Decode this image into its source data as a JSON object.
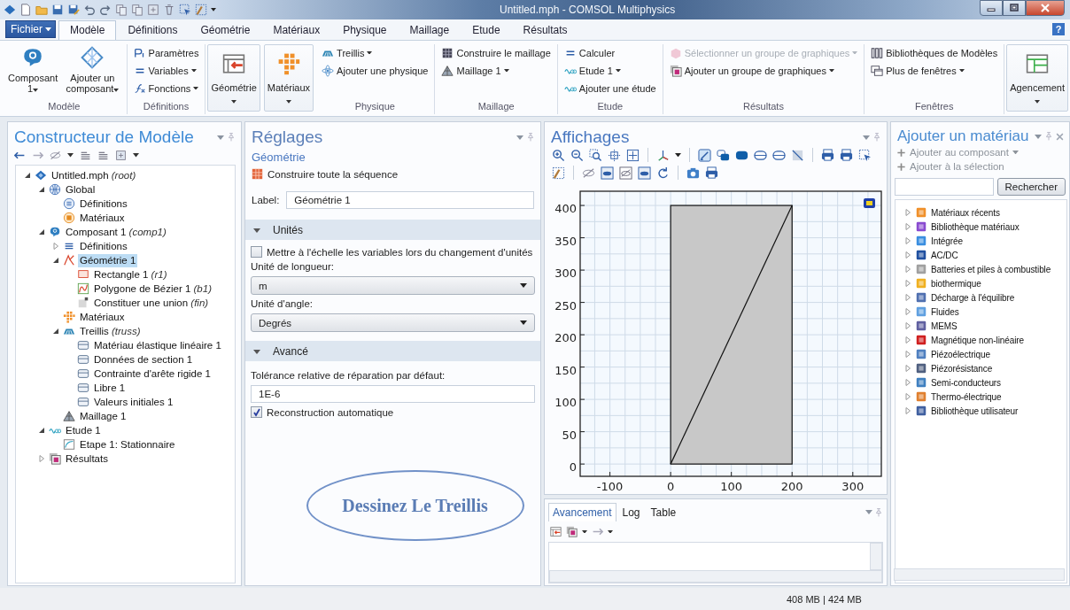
{
  "window": {
    "title": "Untitled.mph - COMSOL Multiphysics"
  },
  "menu_tabs": [
    {
      "label": "Fichier",
      "kind": "file",
      "selected": false
    },
    {
      "label": "Modèle",
      "kind": "tab",
      "selected": true
    },
    {
      "label": "Définitions",
      "kind": "tab",
      "selected": false
    },
    {
      "label": "Géométrie",
      "kind": "tab",
      "selected": false
    },
    {
      "label": "Matériaux",
      "kind": "tab",
      "selected": false
    },
    {
      "label": "Physique",
      "kind": "tab",
      "selected": false
    },
    {
      "label": "Maillage",
      "kind": "tab",
      "selected": false
    },
    {
      "label": "Etude",
      "kind": "tab",
      "selected": false
    },
    {
      "label": "Résultats",
      "kind": "tab",
      "selected": false
    }
  ],
  "help_button": "?",
  "ribbon_groups": [
    {
      "title": "Modèle",
      "items": [
        {
          "kind": "large",
          "label": "Composant 1",
          "dropdown": true,
          "disabled": false
        },
        {
          "kind": "large",
          "label": "Ajouter un composant",
          "dropdown": true,
          "disabled": false
        }
      ]
    },
    {
      "title": "Définitions",
      "items": [
        {
          "kind": "small",
          "label": "Paramètres",
          "dropdown": false,
          "disabled": false
        },
        {
          "kind": "small",
          "label": "Variables",
          "dropdown": true,
          "disabled": false
        },
        {
          "kind": "small",
          "label": "Fonctions",
          "dropdown": true,
          "disabled": false
        }
      ]
    },
    {
      "items": [
        {
          "kind": "split",
          "label": "Géométrie",
          "dropdown": true,
          "disabled": false
        }
      ]
    },
    {
      "items": [
        {
          "kind": "split",
          "label": "Matériaux",
          "dropdown": true,
          "disabled": false
        }
      ]
    },
    {
      "title": "Physique",
      "items": [
        {
          "kind": "small",
          "label": "Treillis",
          "dropdown": true,
          "disabled": false
        },
        {
          "kind": "small",
          "label": "Ajouter une physique",
          "dropdown": false,
          "disabled": false
        }
      ]
    },
    {
      "title": "Maillage",
      "items": [
        {
          "kind": "small",
          "label": "Construire le maillage",
          "dropdown": false,
          "disabled": false
        },
        {
          "kind": "small",
          "label": "Maillage 1",
          "dropdown": true,
          "disabled": false
        }
      ]
    },
    {
      "title": "Etude",
      "items": [
        {
          "kind": "small",
          "label": "Calculer",
          "dropdown": false,
          "disabled": false
        },
        {
          "kind": "small",
          "label": "Etude 1",
          "dropdown": true,
          "disabled": false
        },
        {
          "kind": "small",
          "label": "Ajouter une étude",
          "dropdown": false,
          "disabled": false
        }
      ]
    },
    {
      "title": "Résultats",
      "items": [
        {
          "kind": "small",
          "label": "Sélectionner un groupe de graphiques",
          "dropdown": true,
          "disabled": true
        },
        {
          "kind": "small",
          "label": "Ajouter un groupe de graphiques",
          "dropdown": true,
          "disabled": false
        }
      ]
    },
    {
      "title": "Fenêtres",
      "items": [
        {
          "kind": "small",
          "label": "Bibliothèques de Modèles",
          "dropdown": false,
          "disabled": false
        },
        {
          "kind": "small",
          "label": "Plus de fenêtres",
          "dropdown": true,
          "disabled": false
        }
      ]
    },
    {
      "items": [
        {
          "kind": "split",
          "label": "Agencement",
          "dropdown": true,
          "disabled": false
        }
      ]
    }
  ],
  "model_builder": {
    "title": "Constructeur de Modèle",
    "tree": [
      {
        "label": "Untitled.mph",
        "tag": "(root)",
        "kind": "file",
        "expanded": true,
        "selected": false,
        "children": [
          {
            "label": "Global",
            "kind": "global",
            "expanded": true,
            "selected": false,
            "children": [
              {
                "label": "Définitions",
                "kind": "definitions",
                "selected": false
              },
              {
                "label": "Matériaux",
                "kind": "materials-global",
                "selected": false
              }
            ]
          },
          {
            "label": "Composant 1",
            "tag": "(comp1)",
            "kind": "component",
            "expanded": true,
            "selected": false,
            "children": [
              {
                "label": "Définitions",
                "kind": "list",
                "expanded": false,
                "selected": false
              },
              {
                "label": "Géométrie 1",
                "kind": "geometry",
                "expanded": true,
                "selected": true,
                "children": [
                  {
                    "label": "Rectangle 1",
                    "tag": "(r1)",
                    "kind": "rectangle",
                    "selected": false
                  },
                  {
                    "label": "Polygone de Bézier 1",
                    "tag": "(b1)",
                    "kind": "bezier",
                    "selected": false
                  },
                  {
                    "label": "Constituer une union",
                    "tag": "(fin)",
                    "kind": "union",
                    "selected": false
                  }
                ]
              },
              {
                "label": "Matériaux",
                "kind": "materials",
                "selected": false
              },
              {
                "label": "Treillis",
                "tag": "(truss)",
                "kind": "truss",
                "expanded": true,
                "selected": false,
                "children": [
                  {
                    "label": "Matériau élastique linéaire 1",
                    "kind": "feature",
                    "selected": false
                  },
                  {
                    "label": "Données de section 1",
                    "kind": "feature",
                    "selected": false
                  },
                  {
                    "label": "Contrainte d'arête rigide 1",
                    "kind": "feature",
                    "selected": false
                  },
                  {
                    "label": "Libre 1",
                    "kind": "feature",
                    "selected": false
                  },
                  {
                    "label": "Valeurs initiales 1",
                    "kind": "feature",
                    "selected": false
                  }
                ]
              },
              {
                "label": "Maillage 1",
                "kind": "mesh",
                "selected": false
              }
            ]
          },
          {
            "label": "Etude 1",
            "kind": "study",
            "expanded": true,
            "selected": false,
            "children": [
              {
                "label": "Etape 1: Stationnaire",
                "kind": "step",
                "selected": false
              }
            ]
          },
          {
            "label": "Résultats",
            "kind": "results",
            "expanded": false,
            "selected": false
          }
        ]
      }
    ]
  },
  "settings": {
    "title": "Réglages",
    "subtitle": "Géométrie",
    "action": "Construire toute la séquence",
    "label_field": {
      "label": "Label:",
      "value": "Géométrie 1"
    },
    "sections": [
      {
        "title": "Unités",
        "expanded": true,
        "fields": [
          {
            "kind": "checkbox",
            "label": "Mettre à l'échelle les variables lors du changement d'unités",
            "checked": false
          },
          {
            "kind": "select",
            "label": "Unité de longueur:",
            "value": "m"
          },
          {
            "kind": "select",
            "label": "Unité d'angle:",
            "value": "Degrés"
          }
        ]
      },
      {
        "title": "Avancé",
        "expanded": true,
        "fields": [
          {
            "kind": "text",
            "label": "Tolérance relative de réparation par défaut:",
            "value": "1E-6"
          },
          {
            "kind": "checkbox",
            "label": "Reconstruction automatique",
            "checked": true
          }
        ]
      }
    ],
    "annotation": "Dessinez Le Treillis"
  },
  "graphics": {
    "title": "Affichages",
    "x_ticks": [
      "-100",
      "0",
      "100",
      "200",
      "300"
    ],
    "y_ticks": [
      "400",
      "350",
      "300",
      "250",
      "200",
      "150",
      "100",
      "50",
      "0"
    ]
  },
  "log_panel": {
    "tabs": [
      {
        "label": "Avancement",
        "selected": true
      },
      {
        "label": "Log",
        "selected": false
      },
      {
        "label": "Table",
        "selected": false
      }
    ]
  },
  "material_panel": {
    "title": "Ajouter un matériau",
    "actions": [
      {
        "label": "Ajouter au composant",
        "dropdown": true,
        "disabled": true
      },
      {
        "label": "Ajouter à la sélection",
        "dropdown": false,
        "disabled": true
      }
    ],
    "search_button": "Rechercher",
    "items": [
      {
        "label": "Matériaux récents",
        "expanded": false
      },
      {
        "label": "Bibliothèque matériaux",
        "expanded": false
      },
      {
        "label": "Intégrée",
        "expanded": false
      },
      {
        "label": "AC/DC",
        "expanded": false
      },
      {
        "label": "Batteries et piles à combustible",
        "expanded": false
      },
      {
        "label": "biothermique",
        "expanded": false
      },
      {
        "label": "Décharge à l'équilibre",
        "expanded": false
      },
      {
        "label": "Fluides",
        "expanded": false
      },
      {
        "label": "MEMS",
        "expanded": false
      },
      {
        "label": "Magnétique non-linéaire",
        "expanded": false
      },
      {
        "label": "Piézoélectrique",
        "expanded": false
      },
      {
        "label": "Piézorésistance",
        "expanded": false
      },
      {
        "label": "Semi-conducteurs",
        "expanded": false
      },
      {
        "label": "Thermo-électrique",
        "expanded": false
      },
      {
        "label": "Bibliothèque utilisateur",
        "expanded": false
      }
    ]
  },
  "status_bar": {
    "memory": "408 MB | 424 MB"
  }
}
